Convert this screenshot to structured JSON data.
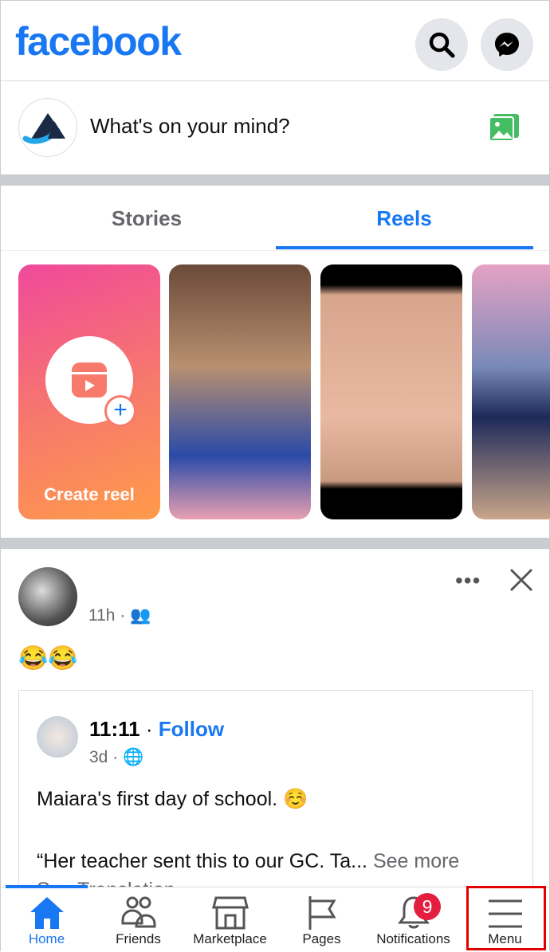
{
  "header": {
    "logo": "facebook",
    "icons": [
      "search-icon",
      "messenger-icon"
    ]
  },
  "composer": {
    "placeholder": "What's on your mind?",
    "icon": "photo-icon"
  },
  "tabs": [
    {
      "label": "Stories",
      "active": false
    },
    {
      "label": "Reels",
      "active": true
    }
  ],
  "reels": {
    "create_label": "Create reel",
    "items": [
      "reel-1",
      "reel-2",
      "reel-3"
    ]
  },
  "post": {
    "time": "11h",
    "separator": "·",
    "audience_icon": "friends-icon",
    "text": "😂😂",
    "shared": {
      "author": "11:11",
      "sep": "·",
      "follow": "Follow",
      "time": "3d",
      "audience_icon": "globe-icon",
      "line1": "Maiara's first day of school. ☺️",
      "line2": "“Her teacher sent this to our GC. Ta...",
      "see_more": "See more",
      "see_translation": "See Translation"
    }
  },
  "nav": [
    {
      "label": "Home",
      "active": true
    },
    {
      "label": "Friends"
    },
    {
      "label": "Marketplace"
    },
    {
      "label": "Pages"
    },
    {
      "label": "Notifications",
      "badge": "9"
    },
    {
      "label": "Menu",
      "highlighted": true
    }
  ],
  "colors": {
    "brand": "#1877f2",
    "badge": "#e41e3f",
    "highlight": "#e00000"
  }
}
